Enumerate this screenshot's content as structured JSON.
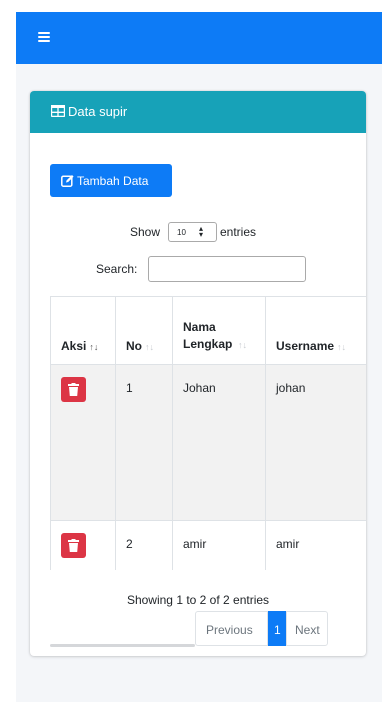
{
  "navbar": {
    "menu_icon": "hamburger-icon",
    "color": "#0d7bf6"
  },
  "card": {
    "icon": "table-icon",
    "title": "Data supir",
    "header_color": "#17a2b8",
    "add_button": {
      "icon": "edit-icon",
      "label": "Tambah Data"
    }
  },
  "length": {
    "show_label": "Show",
    "value": "10",
    "entries_label": "entries"
  },
  "search": {
    "label": "Search:",
    "value": ""
  },
  "table": {
    "columns": [
      "Aksi",
      "No",
      "Nama Lengkap",
      "Username"
    ],
    "rows": [
      {
        "action_icon": "trash-icon",
        "no": "1",
        "nama": "Johan",
        "username": "johan"
      },
      {
        "action_icon": "trash-icon",
        "no": "2",
        "nama": "amir",
        "username": "amir"
      }
    ]
  },
  "info": "Showing 1 to 2 of 2 entries",
  "pagination": {
    "previous": "Previous",
    "current": "1",
    "next": "Next"
  },
  "colors": {
    "primary": "#0d7bf6",
    "danger": "#dc3545",
    "info": "#17a2b8"
  }
}
